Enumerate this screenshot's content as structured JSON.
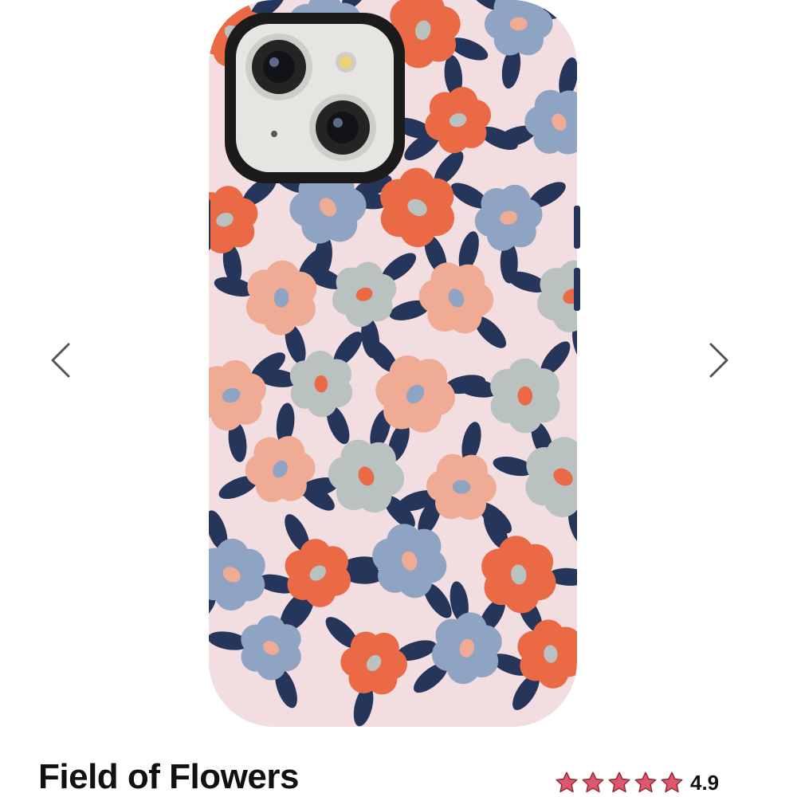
{
  "product": {
    "title": "Field of Flowers",
    "rating": {
      "value": "4.9",
      "stars": 5,
      "star_color": "#e0566a"
    },
    "image": {
      "case_color": "#f2dde0",
      "flower_colors": [
        "#ea6a46",
        "#f0ab95",
        "#8fa3c2",
        "#b9c2c1"
      ],
      "leaf_color": "#26355a"
    }
  },
  "carousel": {
    "prev_icon": "chevron-left-icon",
    "next_icon": "chevron-right-icon",
    "arrow_color": "#555555"
  }
}
